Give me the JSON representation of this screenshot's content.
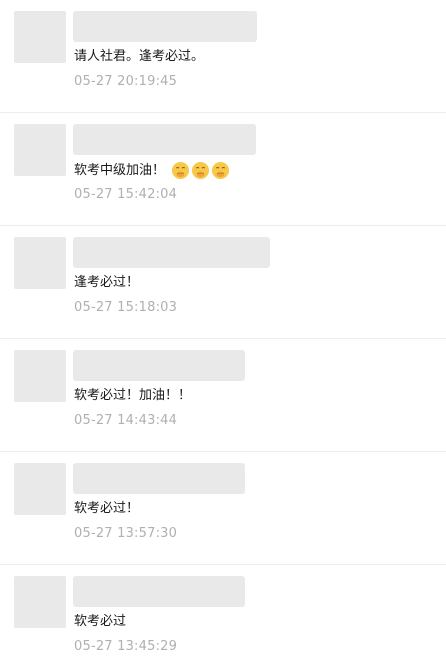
{
  "comments": [
    {
      "text": "请人社君。逢考必过。",
      "time": "05-27 20:19:45",
      "emojis": []
    },
    {
      "text": "软考中级加油！",
      "time": "05-27 15:42:04",
      "emojis": [
        "face-with-hand-over-mouth",
        "face-with-hand-over-mouth",
        "face-with-hand-over-mouth"
      ]
    },
    {
      "text": "逢考必过！",
      "time": "05-27 15:18:03",
      "emojis": []
    },
    {
      "text": "软考必过！加油！！",
      "time": "05-27 14:43:44",
      "emojis": []
    },
    {
      "text": "软考必过！",
      "time": "05-27 13:57:30",
      "emojis": []
    },
    {
      "text": "软考必过",
      "time": "05-27 13:45:29",
      "emojis": []
    }
  ],
  "colors": {
    "placeholder": "#e9e9e9",
    "timestamp": "#b0b0b0",
    "divider": "#ececec",
    "emoji_fill": "#f7c948"
  }
}
